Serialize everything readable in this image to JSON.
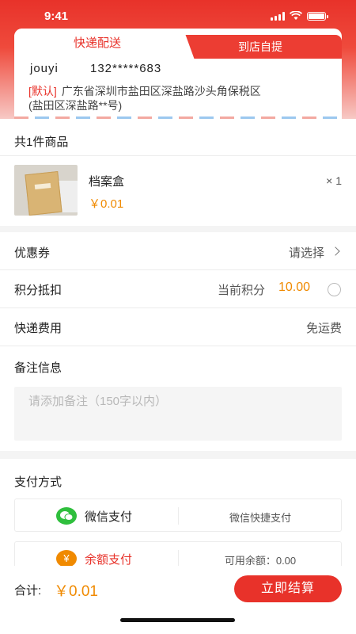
{
  "status_bar": {
    "time": "9:41"
  },
  "delivery_tabs": {
    "active": "快递配送",
    "inactive": "到店自提"
  },
  "address": {
    "name": "jouyi",
    "phone": "132*****683",
    "default_tag": "[默认]",
    "line1": "广东省深圳市盐田区深盐路沙头角保税区",
    "line2": "(盐田区深盐路**号)"
  },
  "goods": {
    "count_title": "共1件商品",
    "item": {
      "name": "档案盒",
      "price": "￥0.01",
      "qty": "× 1"
    }
  },
  "coupon": {
    "label": "优惠券",
    "value": "请选择"
  },
  "points": {
    "label": "积分抵扣",
    "current_label": "当前积分",
    "current_value": "10.00"
  },
  "shipping": {
    "label": "快递费用",
    "value": "免运费"
  },
  "note": {
    "label": "备注信息",
    "placeholder": "请添加备注（150字以内）"
  },
  "payment": {
    "title": "支付方式",
    "methods": [
      {
        "icon": "wechat-icon",
        "name": "微信支付",
        "desc": "微信快捷支付",
        "color": "#2fbf3d"
      },
      {
        "icon": "yen-icon",
        "name": "余额支付",
        "desc": "可用余额：0.00",
        "color": "#f08a00"
      }
    ]
  },
  "footer": {
    "total_label": "合计:",
    "total_value": "￥0.01",
    "checkout": "立即结算"
  },
  "colors": {
    "brand_red": "#e8322a",
    "price_orange": "#f08a00"
  }
}
